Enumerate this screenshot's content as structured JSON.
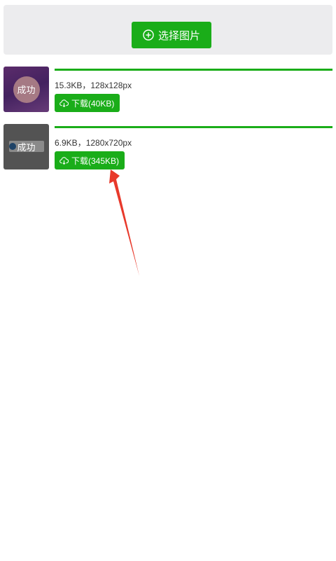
{
  "upload": {
    "select_label": "选择图片",
    "icon": "plus-circle-icon"
  },
  "files": [
    {
      "status": "成功",
      "info": "15.3KB，128x128px",
      "download_label": "下载(40KB)",
      "progress": 1.0
    },
    {
      "status": "成功",
      "info": "6.9KB，1280x720px",
      "download_label": "下载(345KB)",
      "progress": 1.0
    }
  ],
  "colors": {
    "accent": "#1aad19",
    "panel_bg": "#ececee",
    "annotation_arrow": "#e8392b"
  }
}
